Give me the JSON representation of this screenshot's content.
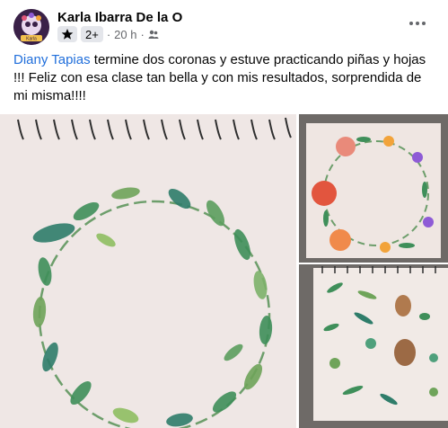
{
  "post": {
    "author": "Karla Ibarra De la O",
    "avatar_label": "Karla",
    "friend_count": "2+",
    "time": "20 h",
    "separator": "·",
    "mention": "Diany Tapias",
    "text": " termine dos coronas y estuve practicando piñas y hojas !!! Feliz con esa clase tan bella y con mis resultados, sorprendida de mi misma!!!!"
  },
  "icons": {
    "more": "more-horizontal-icon",
    "star": "star-icon",
    "privacy": "friends-privacy-icon"
  },
  "colors": {
    "mention": "#216fdb",
    "secondary": "#65676b",
    "leaf_green": "#3f8f5a",
    "rose": "#e2553e",
    "paper": "#f3ecea"
  }
}
